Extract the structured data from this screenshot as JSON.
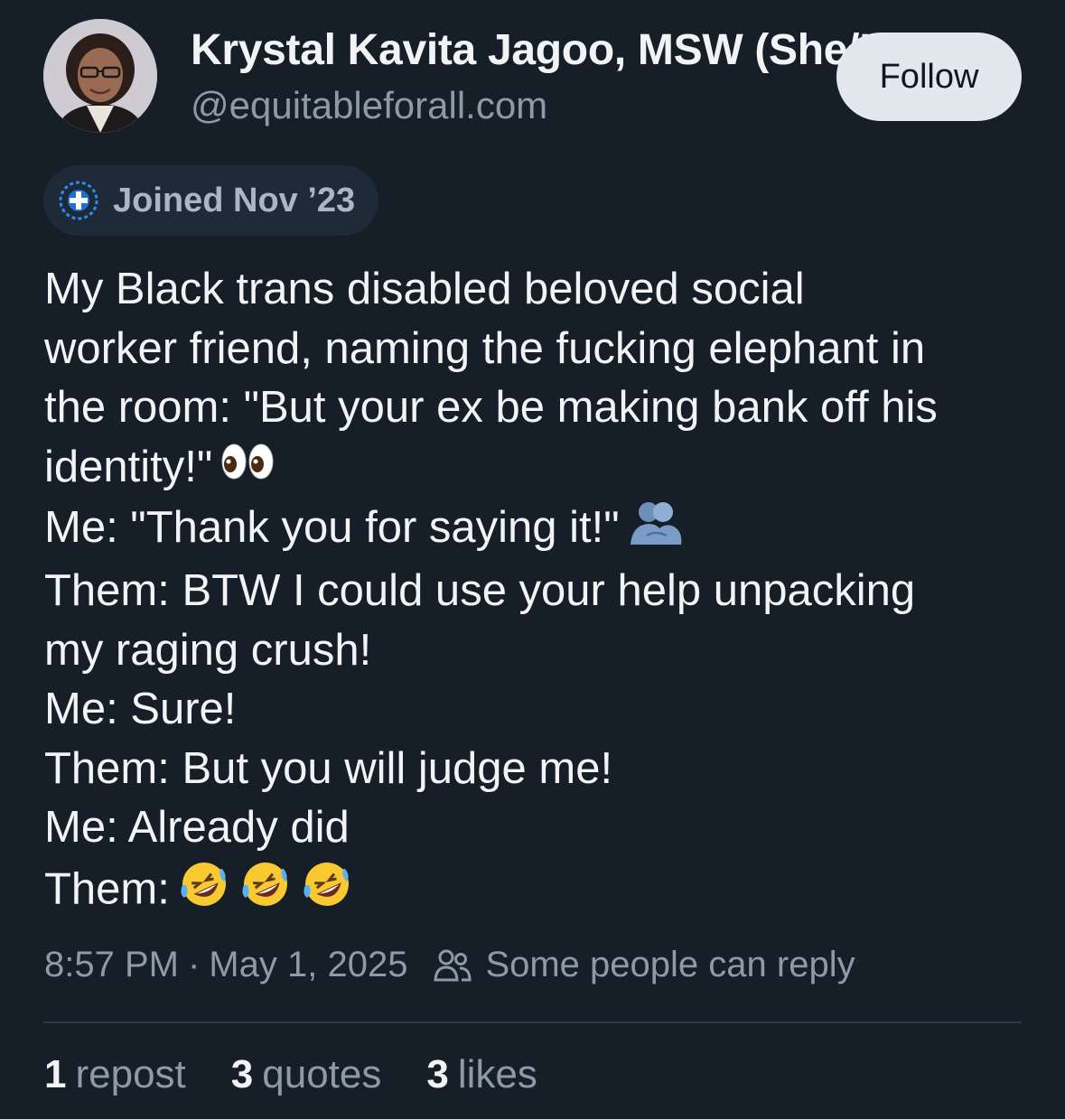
{
  "author": {
    "display_name": "Krystal Kavita Jagoo, MSW (She/Her)",
    "handle": "@equitableforall.com",
    "follow_label": "Follow",
    "joined_label": "Joined Nov ’23"
  },
  "post": {
    "lines": [
      "My Black trans disabled beloved social",
      "worker friend, naming the fucking elephant in",
      "the room: \"But your ex be making bank off his",
      "identity!\"",
      "Me: \"Thank you for saying it!\"",
      "Them: BTW I could use your help unpacking",
      "my raging crush!",
      "Me: Sure!",
      "Them: But you will judge me!",
      "Me: Already did",
      "Them:"
    ],
    "emojis": {
      "line_4": "eyes-emoji",
      "line_5": "people-hugging-emoji",
      "line_11": [
        "rofl-emoji",
        "rofl-emoji",
        "rofl-emoji"
      ]
    }
  },
  "meta": {
    "time": "8:57 PM",
    "separator": "·",
    "date": "May 1, 2025",
    "reply_setting": "Some people can reply",
    "reply_icon": "people-icon"
  },
  "stats": {
    "reposts_count": "1",
    "reposts_label": "repost",
    "quotes_count": "3",
    "quotes_label": "quotes",
    "likes_count": "3",
    "likes_label": "likes"
  },
  "colors": {
    "background": "#161e27",
    "text_primary": "#f1f3f5",
    "text_secondary": "#8d9aa8",
    "follow_button_bg": "#e3e8ef",
    "badge_bg": "#1e2a38"
  }
}
